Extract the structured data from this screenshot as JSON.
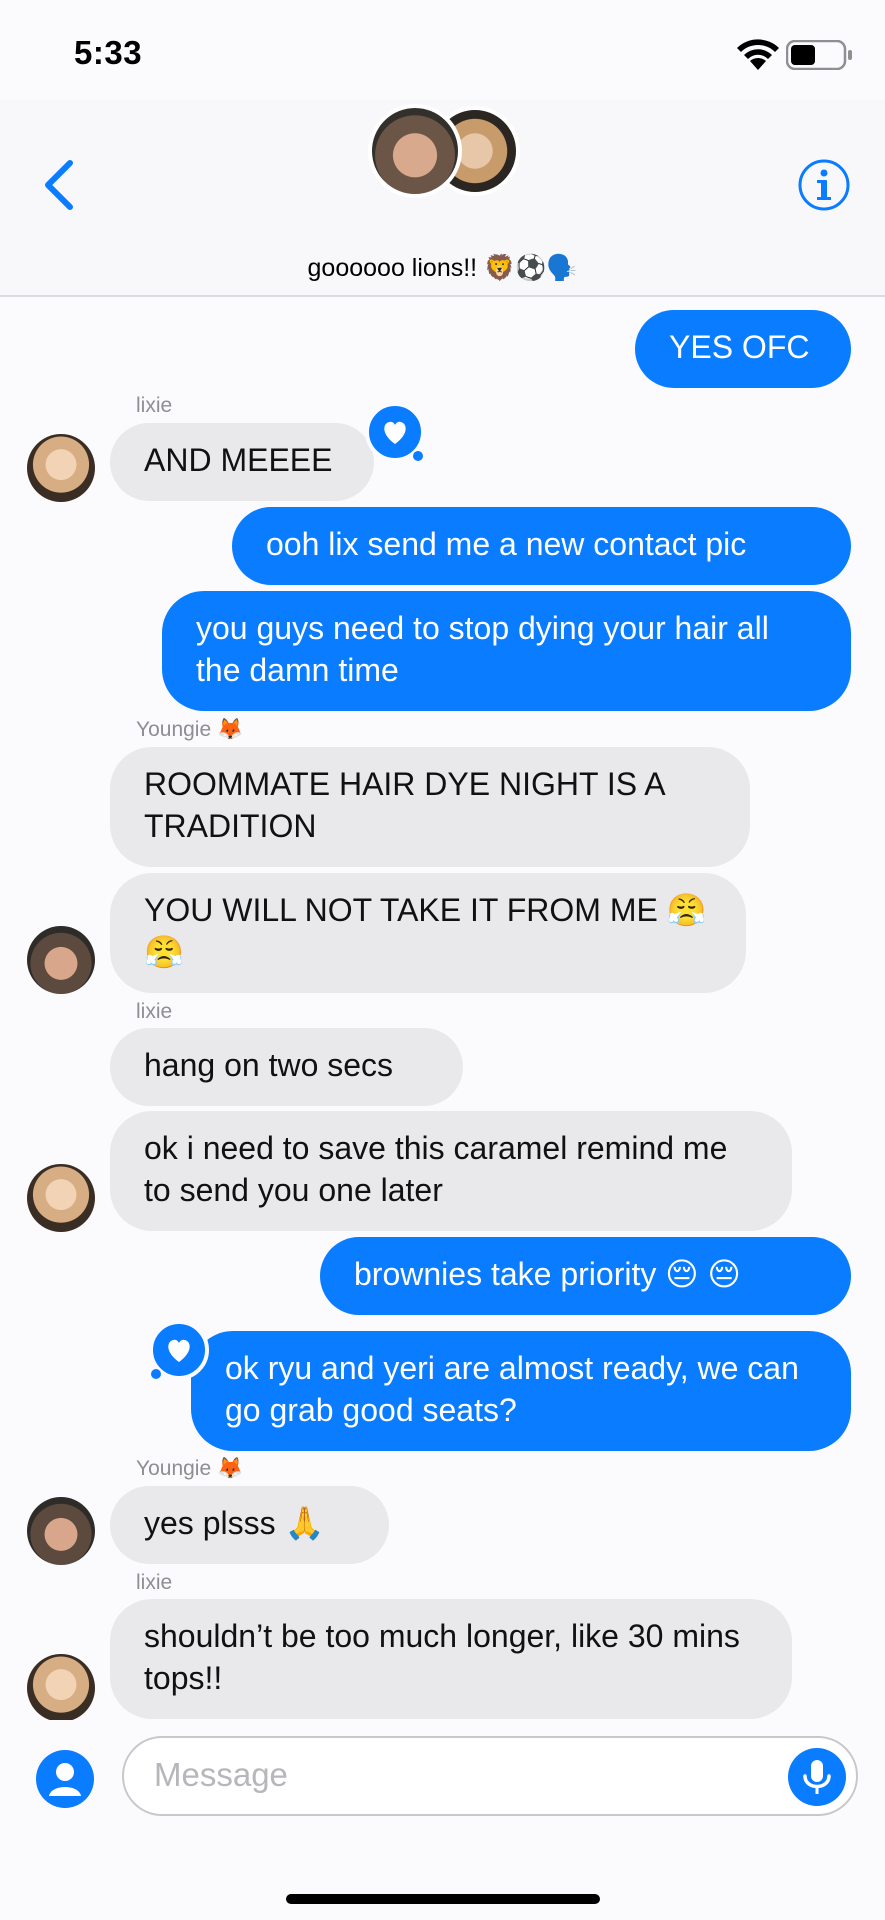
{
  "status": {
    "time": "5:33",
    "icons": [
      "wifi-icon",
      "battery-icon"
    ]
  },
  "header": {
    "title": "goooooo lions!! 🦁⚽🗣️",
    "back_icon": "chevron-left-icon",
    "info_icon": "info-icon"
  },
  "colors": {
    "accent": "#0a7cff",
    "incoming": "#e9e9eb"
  },
  "messages": {
    "m1": "YES OFC",
    "s1": "lixie",
    "m2": "AND MEEEE",
    "m3": "ooh lix send me a new contact pic",
    "m4": "you guys need to stop dying your hair all the damn time",
    "s2": "Youngie 🦊",
    "m5": "ROOMMATE HAIR DYE NIGHT IS A TRADITION",
    "m6": "YOU WILL NOT TAKE IT FROM ME 😤 😤",
    "s3": "lixie",
    "m7": "hang on two secs",
    "m8": "ok i need to save this caramel remind me to send you one later",
    "m9": "brownies take priority 😔 😔",
    "m10": "ok ryu and yeri are almost ready, we can go grab good seats?",
    "s4": "Youngie 🦊",
    "m11": "yes plsss 🙏",
    "s5": "lixie",
    "m12": "shouldn’t be too much longer, like 30 mins tops!!"
  },
  "composer": {
    "placeholder": "Message",
    "apps_icon": "person-icon",
    "mic_icon": "mic-icon"
  }
}
